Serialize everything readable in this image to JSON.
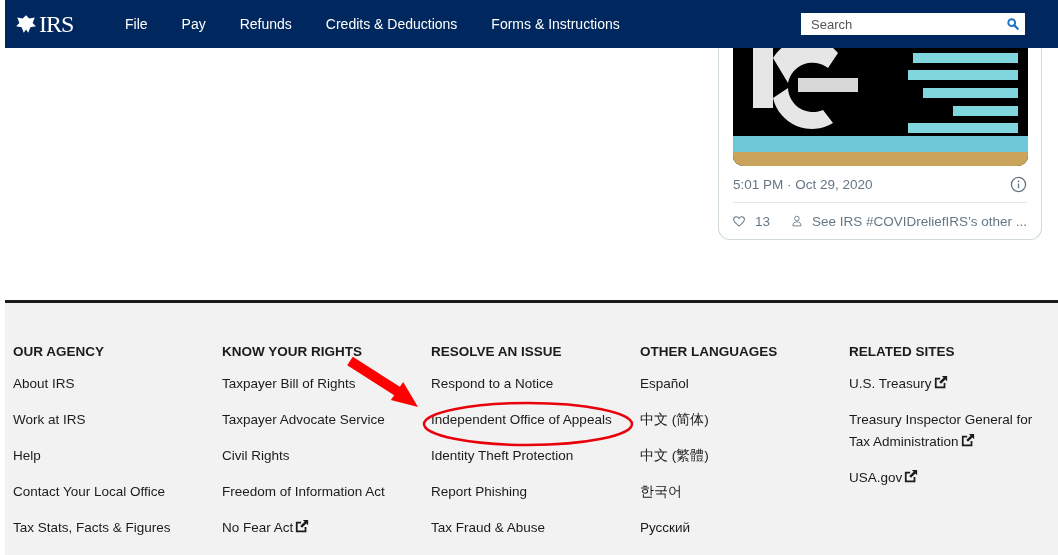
{
  "nav": {
    "logo": "IRS",
    "items": [
      "File",
      "Pay",
      "Refunds",
      "Credits & Deductions",
      "Forms & Instructions"
    ],
    "search": {
      "placeholder": "Search"
    }
  },
  "tweet": {
    "time": "5:01 PM · Oct 29, 2020",
    "likes": "13",
    "more": "See IRS #COVIDreliefIRS’s other ..."
  },
  "footer": {
    "columns": [
      {
        "heading": "OUR AGENCY",
        "links": [
          {
            "text": "About IRS",
            "external": false
          },
          {
            "text": "Work at IRS",
            "external": false
          },
          {
            "text": "Help",
            "external": false
          },
          {
            "text": "Contact Your Local Office",
            "external": false
          },
          {
            "text": "Tax Stats, Facts & Figures",
            "external": false
          }
        ]
      },
      {
        "heading": "KNOW YOUR RIGHTS",
        "links": [
          {
            "text": "Taxpayer Bill of Rights",
            "external": false
          },
          {
            "text": "Taxpayer Advocate Service",
            "external": false
          },
          {
            "text": "Civil Rights",
            "external": false
          },
          {
            "text": "Freedom of Information Act",
            "external": false
          },
          {
            "text": "No Fear Act",
            "external": true
          }
        ]
      },
      {
        "heading": "RESOLVE AN ISSUE",
        "links": [
          {
            "text": "Respond to a Notice",
            "external": false
          },
          {
            "text": "Independent Office of Appeals",
            "external": false
          },
          {
            "text": "Identity Theft Protection",
            "external": false
          },
          {
            "text": "Report Phishing",
            "external": false
          },
          {
            "text": "Tax Fraud & Abuse",
            "external": false
          }
        ]
      },
      {
        "heading": "OTHER LANGUAGES",
        "links": [
          {
            "text": "Español",
            "external": false
          },
          {
            "text": "中文 (简体)",
            "external": false
          },
          {
            "text": "中文 (繁體)",
            "external": false
          },
          {
            "text": "한국어",
            "external": false
          },
          {
            "text": "Русский",
            "external": false
          }
        ]
      },
      {
        "heading": "RELATED SITES",
        "links": [
          {
            "text": "U.S. Treasury",
            "external": true
          },
          {
            "text": "Treasury Inspector General for Tax Administration",
            "external": true
          },
          {
            "text": "USA.gov",
            "external": true
          }
        ]
      }
    ]
  },
  "annotations": {
    "arrow": true,
    "ellipse": true
  }
}
